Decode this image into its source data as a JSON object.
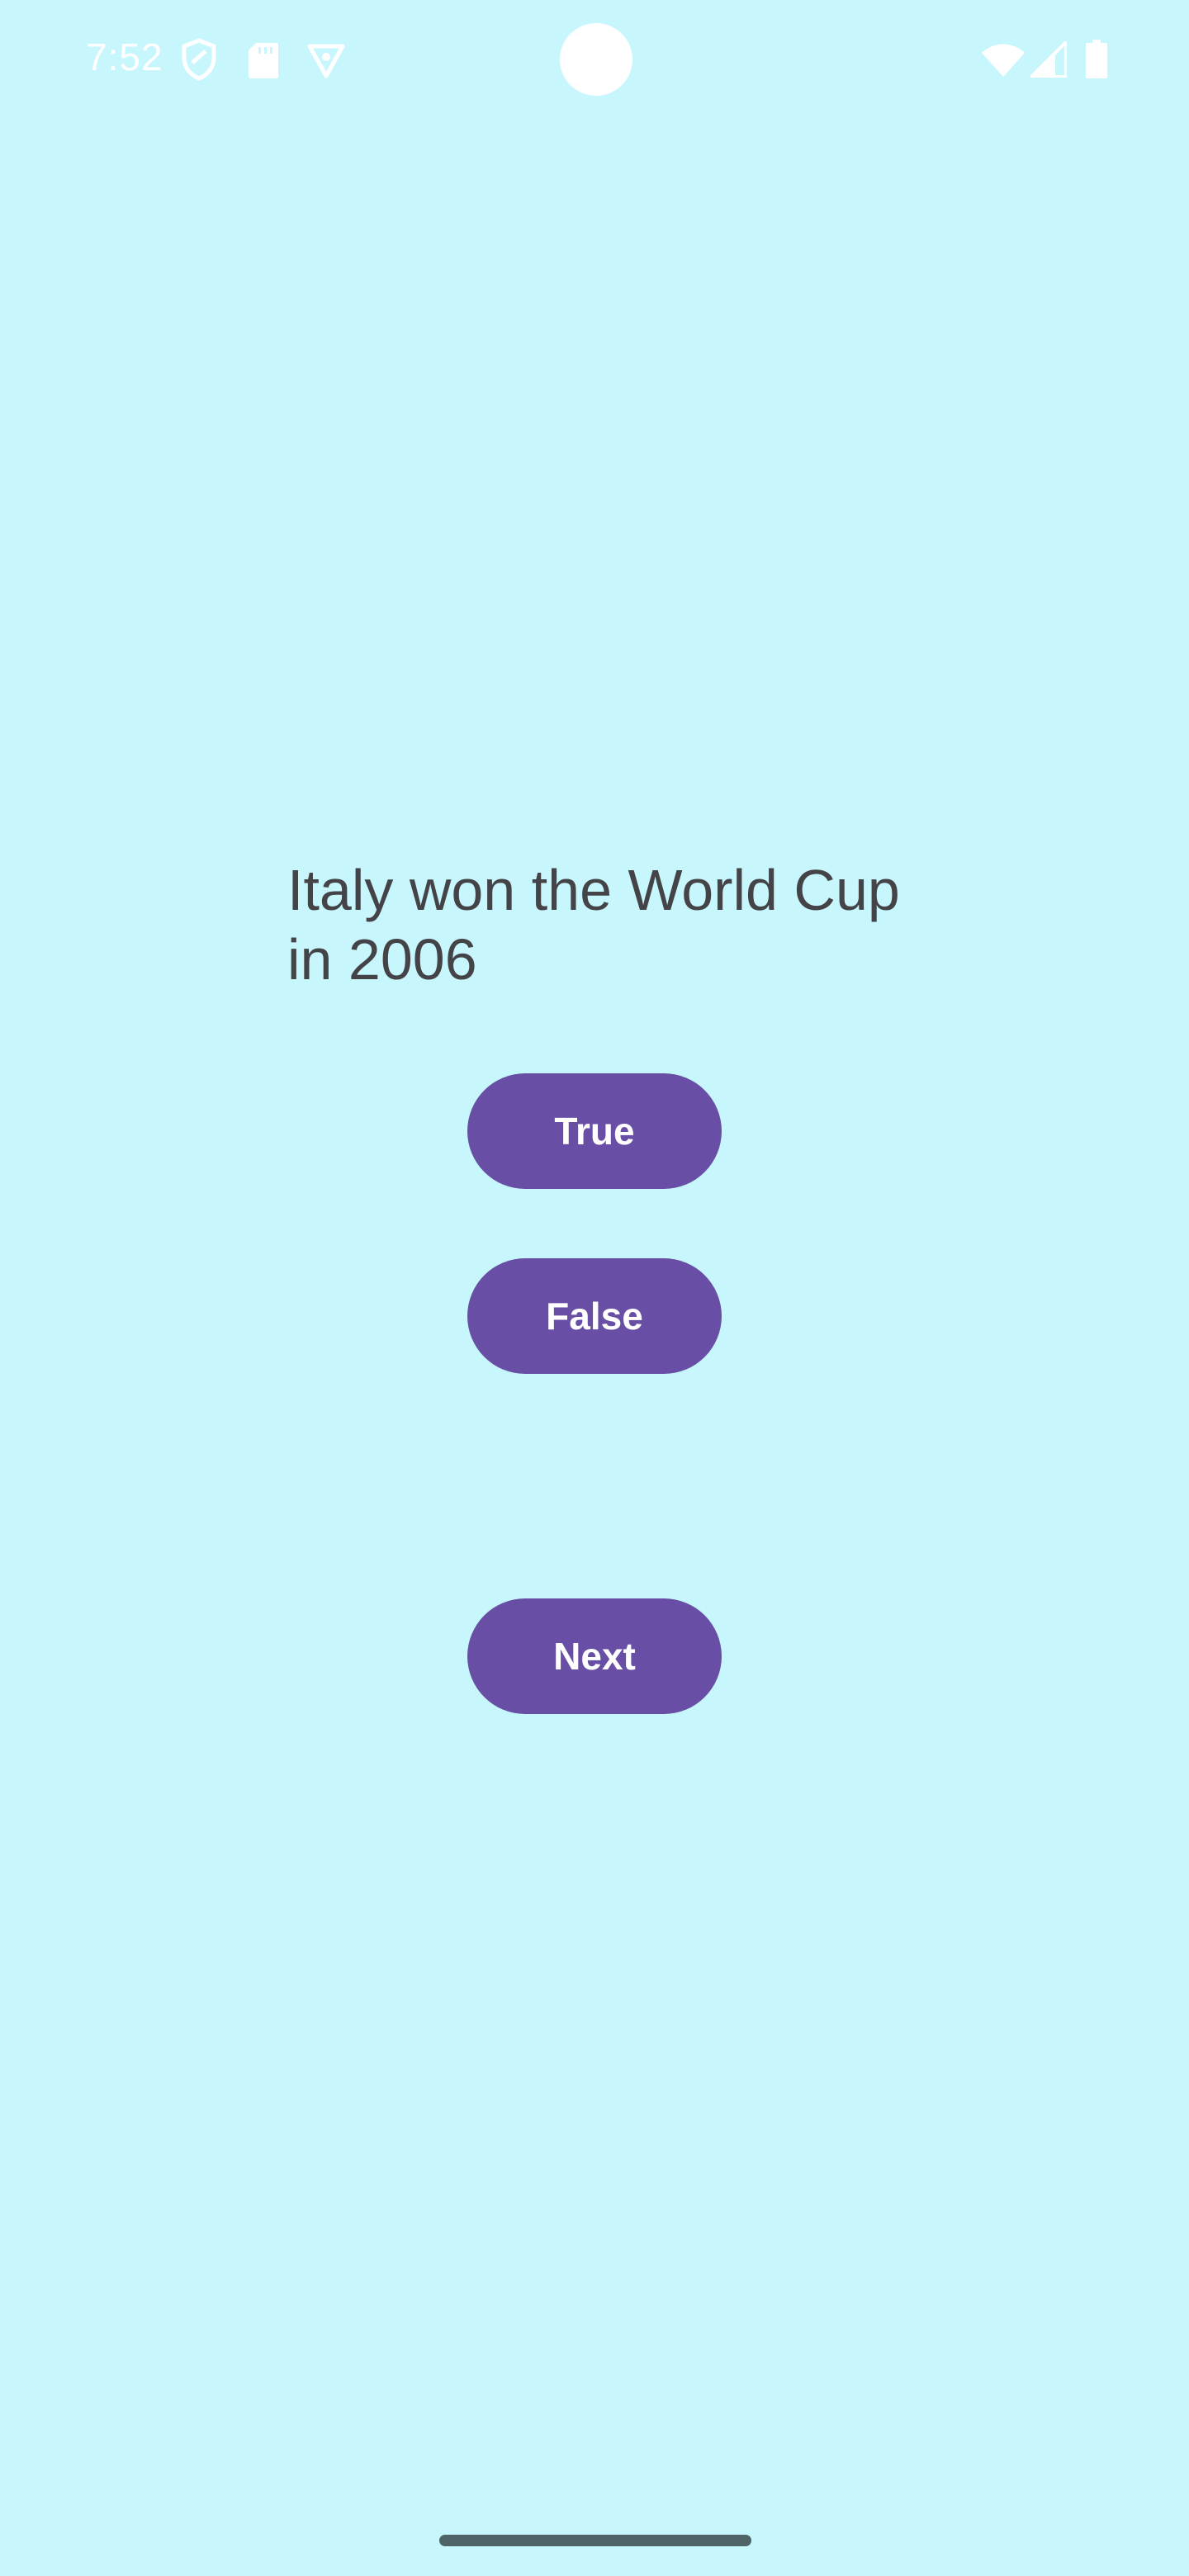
{
  "status_bar": {
    "time": "7:52",
    "left_icons": [
      "shield-icon",
      "sd-card-icon",
      "vpn-icon"
    ],
    "right_icons": [
      "wifi-icon",
      "signal-icon",
      "battery-icon"
    ]
  },
  "question": {
    "text": "Italy won the World Cup in 2006"
  },
  "buttons": {
    "true_label": "True",
    "false_label": "False",
    "next_label": "Next"
  },
  "colors": {
    "background": "#c7f7fc",
    "button": "#684ea4",
    "question_text": "#444448"
  }
}
